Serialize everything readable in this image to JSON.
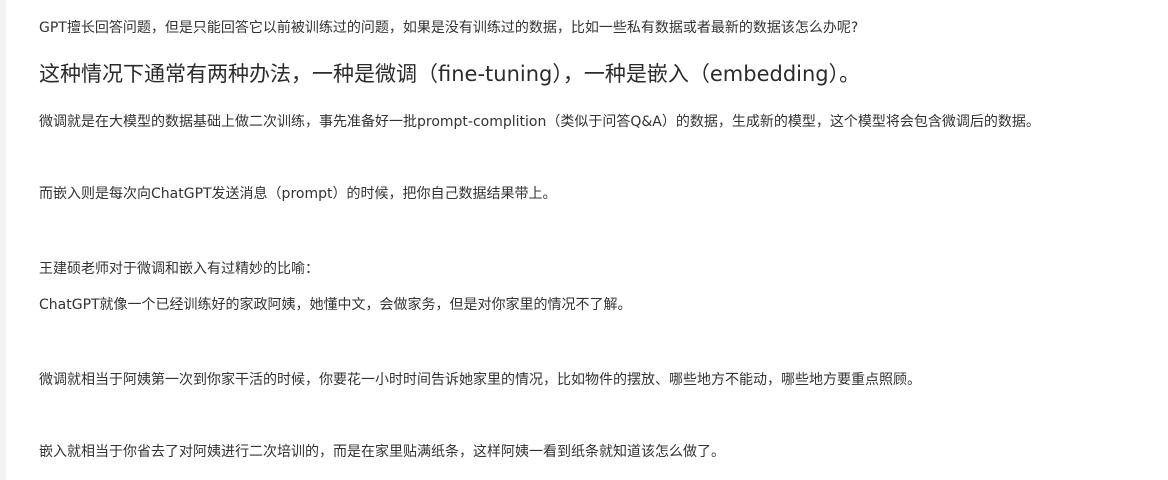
{
  "article": {
    "paragraphs": [
      "GPT擅长回答问题，但是只能回答它以前被训练过的问题，如果是没有训练过的数据，比如一些私有数据或者最新的数据该怎么办呢?",
      "微调就是在大模型的数据基础上做二次训练，事先准备好一批prompt-complition（类似于问答Q&A）的数据，生成新的模型，这个模型将会包含微调后的数据。",
      "而嵌入则是每次向ChatGPT发送消息（prompt）的时候，把你自己数据结果带上。",
      "王建硕老师对于微调和嵌入有过精妙的比喻：",
      "ChatGPT就像一个已经训练好的家政阿姨，她懂中文，会做家务，但是对你家里的情况不了解。",
      "微调就相当于阿姨第一次到你家干活的时候，你要花一小时时间告诉她家里的情况，比如物件的摆放、哪些地方不能动，哪些地方要重点照顾。",
      "嵌入就相当于你省去了对阿姨进行二次培训的，而是在家里贴满纸条，这样阿姨一看到纸条就知道该怎么做了。"
    ],
    "heading": "这种情况下通常有两种办法，一种是微调（fine-tuning），一种是嵌入（embedding）。"
  }
}
